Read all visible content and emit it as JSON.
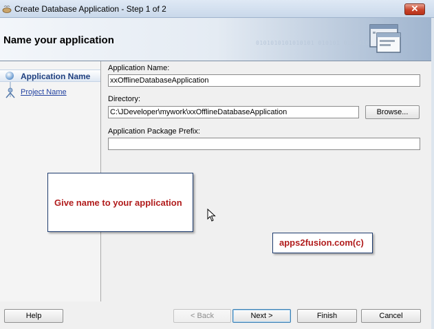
{
  "window": {
    "title": "Create Database Application - Step 1 of 2",
    "close_label": "✕"
  },
  "header": {
    "title": "Name your application",
    "binary_art": "0101010101010101 010101 01010101010 10"
  },
  "train": {
    "steps": [
      {
        "label": "Application Name",
        "active": true
      },
      {
        "label": "Project Name",
        "active": false
      }
    ]
  },
  "form": {
    "app_name_label": "Application Name:",
    "app_name_value": "xxOfflineDatabaseApplication",
    "directory_label": "Directory:",
    "directory_value": "C:\\JDeveloper\\mywork\\xxOfflineDatabaseApplication",
    "browse_label": "Browse...",
    "prefix_label": "Application Package Prefix:",
    "prefix_value": ""
  },
  "annotations": {
    "callout_text": "Give name to your application",
    "brand_text": "apps2fusion.com(c)"
  },
  "footer": {
    "help_label": "Help",
    "back_label": "< Back",
    "next_label": "Next >",
    "finish_label": "Finish",
    "cancel_label": "Cancel"
  },
  "colors": {
    "callout_text": "#b11c1c",
    "link_blue": "#1f3f9f",
    "close_red": "#c8452c"
  }
}
